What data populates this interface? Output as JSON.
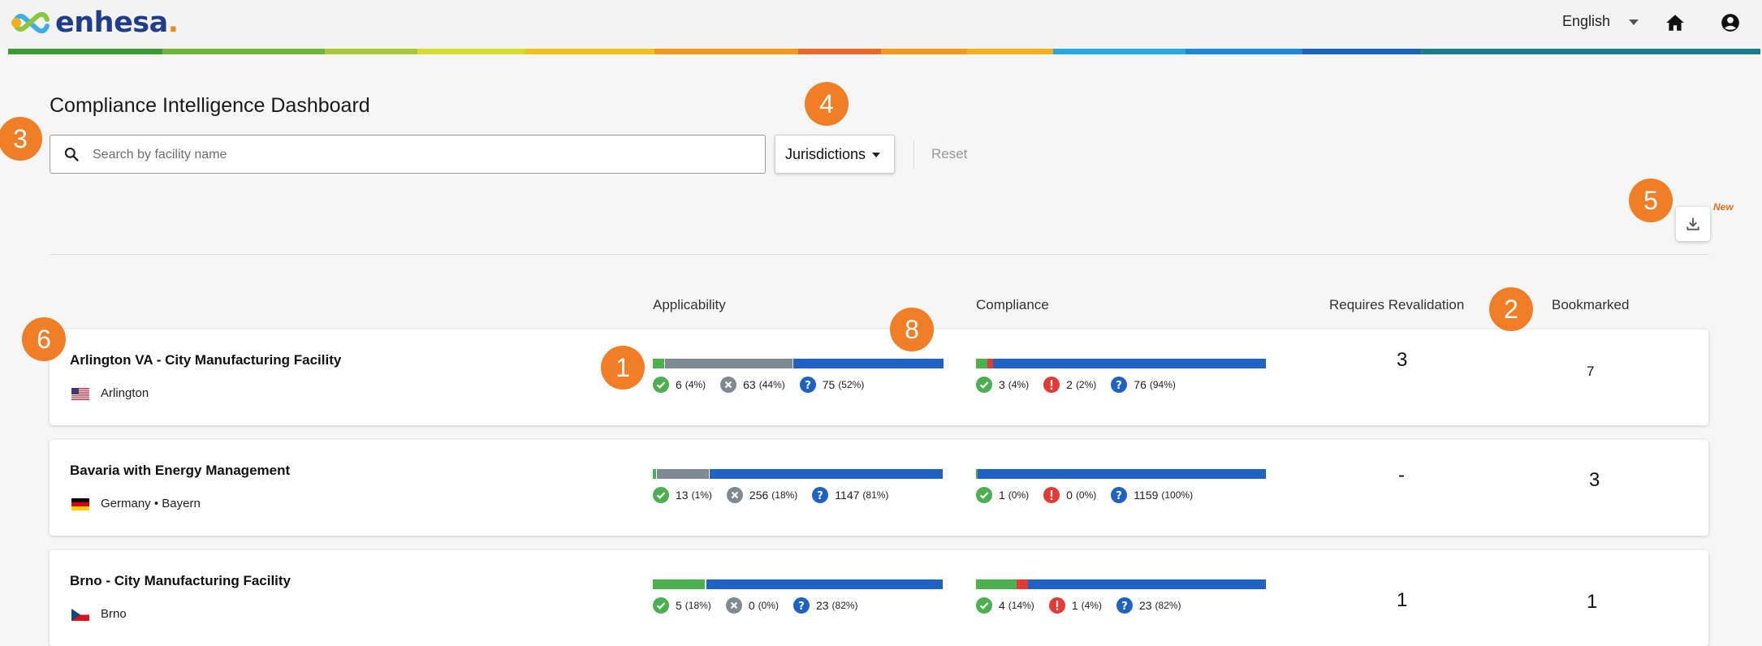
{
  "header": {
    "logo_text": "enhesa",
    "logo_dot": ".",
    "language": "English",
    "home_icon": "home-icon",
    "user_icon": "account-circle-icon",
    "rainbow_colors": [
      "#3d9b35",
      "#6fb53a",
      "#a8c83a",
      "#d6dc2a",
      "#f2c21c",
      "#f39a1c",
      "#e8692a",
      "#f39a1c",
      "#f2b01c",
      "#2aa9e0",
      "#1e88d4",
      "#1a63b8",
      "#1a7f8a"
    ]
  },
  "page": {
    "title": "Compliance Intelligence Dashboard",
    "search_placeholder": "Search by facility name",
    "jurisdictions_label": "Jurisdictions",
    "reset_label": "Reset",
    "new_badge": "New",
    "download_icon": "download-icon"
  },
  "columns": {
    "applicability": "Applicability",
    "compliance": "Compliance",
    "requires_revalidation": "Requires Revalidation",
    "bookmarked": "Bookmarked"
  },
  "colors": {
    "green": "#4caf50",
    "gray": "#7d8a92",
    "blue": "#1e63c4",
    "red": "#e53935",
    "marker": "#f07e26"
  },
  "facilities": [
    {
      "name": "Arlington VA - City Manufacturing Facility",
      "location": "Arlington",
      "flag": "us",
      "applicability": {
        "applicable": "6",
        "applicable_pct": "(4%)",
        "not_applicable": "63",
        "not_applicable_pct": "(44%)",
        "unknown": "75",
        "unknown_pct": "(52%)",
        "shares": [
          0.04,
          0.44,
          0.52
        ]
      },
      "compliance": {
        "compliant": "3",
        "compliant_pct": "(4%)",
        "non_compliant": "2",
        "non_compliant_pct": "(2%)",
        "unknown": "76",
        "unknown_pct": "(94%)",
        "shares": [
          0.04,
          0.02,
          0.94
        ]
      },
      "requires_revalidation": "3",
      "bookmarked": "7"
    },
    {
      "name": "Bavaria with Energy Management",
      "location": "Germany • Bayern",
      "flag": "de",
      "applicability": {
        "applicable": "13",
        "applicable_pct": "(1%)",
        "not_applicable": "256",
        "not_applicable_pct": "(18%)",
        "unknown": "1147",
        "unknown_pct": "(81%)",
        "shares": [
          0.01,
          0.18,
          0.81
        ]
      },
      "compliance": {
        "compliant": "1",
        "compliant_pct": "(0%)",
        "non_compliant": "0",
        "non_compliant_pct": "(0%)",
        "unknown": "1159",
        "unknown_pct": "(100%)",
        "shares": [
          0.005,
          0.0,
          0.995
        ]
      },
      "requires_revalidation": "-",
      "bookmarked": "3"
    },
    {
      "name": "Brno - City Manufacturing Facility",
      "location": "Brno",
      "flag": "cz",
      "applicability": {
        "applicable": "5",
        "applicable_pct": "(18%)",
        "not_applicable": "0",
        "not_applicable_pct": "(0%)",
        "unknown": "23",
        "unknown_pct": "(82%)",
        "shares": [
          0.18,
          0.0,
          0.82
        ]
      },
      "compliance": {
        "compliant": "4",
        "compliant_pct": "(14%)",
        "non_compliant": "1",
        "non_compliant_pct": "(4%)",
        "unknown": "23",
        "unknown_pct": "(82%)",
        "shares": [
          0.14,
          0.04,
          0.82
        ]
      },
      "requires_revalidation": "1",
      "bookmarked": "1"
    }
  ],
  "markers": [
    "1",
    "2",
    "3",
    "4",
    "5",
    "6",
    "8"
  ]
}
